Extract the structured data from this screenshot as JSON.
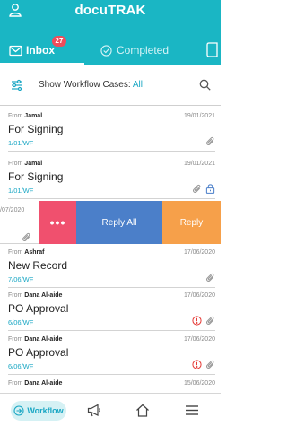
{
  "header": {
    "title": "docuTRAK",
    "tabs": [
      {
        "label": "Inbox",
        "badge": "27",
        "active": true
      },
      {
        "label": "Completed",
        "active": false
      }
    ]
  },
  "filter": {
    "label": "Show Workflow Cases:",
    "value": "All"
  },
  "cards": [
    {
      "from_prefix": "From",
      "from": "Jamal",
      "date": "19/01/2021",
      "title": "For Signing",
      "ref": "1/01/WF",
      "icons": [
        "paperclip-icon"
      ]
    },
    {
      "from_prefix": "From",
      "from": "Jamal",
      "date": "19/01/2021",
      "title": "For Signing",
      "ref": "1/01/WF",
      "icons": [
        "paperclip-icon",
        "lock-icon"
      ]
    },
    {
      "from_prefix": "From",
      "from": "Ashraf",
      "date": "17/06/2020",
      "title": "New Record",
      "ref": "7/06/WF",
      "icons": [
        "paperclip-icon"
      ]
    },
    {
      "from_prefix": "From",
      "from": "Dana Al-aide",
      "date": "17/06/2020",
      "title": "PO Approval",
      "ref": "6/06/WF",
      "icons": [
        "alert-icon",
        "paperclip-icon"
      ]
    },
    {
      "from_prefix": "From",
      "from": "Dana Al-aide",
      "date": "17/06/2020",
      "title": "PO Approval",
      "ref": "6/06/WF",
      "icons": [
        "alert-icon",
        "paperclip-icon"
      ]
    },
    {
      "from_prefix": "From",
      "from": "Dana Al-aide",
      "date": "15/06/2020"
    }
  ],
  "swipe": {
    "date": "/07/2020",
    "more_label": "•••",
    "reply_all_label": "Reply All",
    "reply_label": "Reply"
  },
  "nav": {
    "workflow_label": "Workflow"
  },
  "colors": {
    "accent": "#1ab6c4",
    "link": "#1aa7c4",
    "badge": "#ef4c5a",
    "more": "#f0506e",
    "reply_all": "#4b7fc9",
    "reply": "#f6a04a",
    "alert": "#e53935"
  }
}
